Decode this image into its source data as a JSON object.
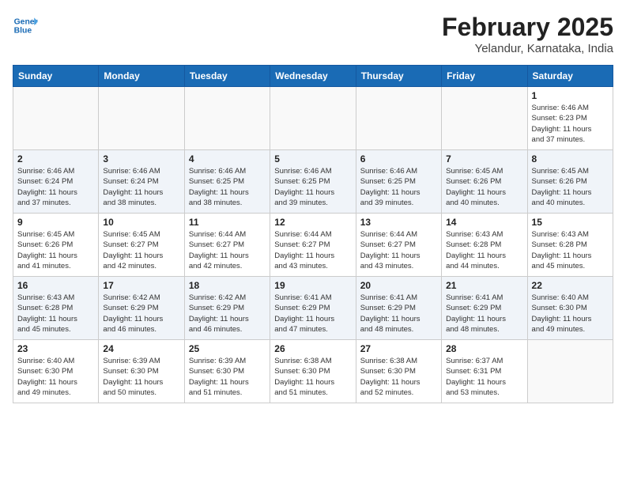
{
  "header": {
    "logo_line1": "General",
    "logo_line2": "Blue",
    "month": "February 2025",
    "location": "Yelandur, Karnataka, India"
  },
  "weekdays": [
    "Sunday",
    "Monday",
    "Tuesday",
    "Wednesday",
    "Thursday",
    "Friday",
    "Saturday"
  ],
  "weeks": [
    [
      {
        "day": "",
        "info": ""
      },
      {
        "day": "",
        "info": ""
      },
      {
        "day": "",
        "info": ""
      },
      {
        "day": "",
        "info": ""
      },
      {
        "day": "",
        "info": ""
      },
      {
        "day": "",
        "info": ""
      },
      {
        "day": "1",
        "info": "Sunrise: 6:46 AM\nSunset: 6:23 PM\nDaylight: 11 hours\nand 37 minutes."
      }
    ],
    [
      {
        "day": "2",
        "info": "Sunrise: 6:46 AM\nSunset: 6:24 PM\nDaylight: 11 hours\nand 37 minutes."
      },
      {
        "day": "3",
        "info": "Sunrise: 6:46 AM\nSunset: 6:24 PM\nDaylight: 11 hours\nand 38 minutes."
      },
      {
        "day": "4",
        "info": "Sunrise: 6:46 AM\nSunset: 6:25 PM\nDaylight: 11 hours\nand 38 minutes."
      },
      {
        "day": "5",
        "info": "Sunrise: 6:46 AM\nSunset: 6:25 PM\nDaylight: 11 hours\nand 39 minutes."
      },
      {
        "day": "6",
        "info": "Sunrise: 6:46 AM\nSunset: 6:25 PM\nDaylight: 11 hours\nand 39 minutes."
      },
      {
        "day": "7",
        "info": "Sunrise: 6:45 AM\nSunset: 6:26 PM\nDaylight: 11 hours\nand 40 minutes."
      },
      {
        "day": "8",
        "info": "Sunrise: 6:45 AM\nSunset: 6:26 PM\nDaylight: 11 hours\nand 40 minutes."
      }
    ],
    [
      {
        "day": "9",
        "info": "Sunrise: 6:45 AM\nSunset: 6:26 PM\nDaylight: 11 hours\nand 41 minutes."
      },
      {
        "day": "10",
        "info": "Sunrise: 6:45 AM\nSunset: 6:27 PM\nDaylight: 11 hours\nand 42 minutes."
      },
      {
        "day": "11",
        "info": "Sunrise: 6:44 AM\nSunset: 6:27 PM\nDaylight: 11 hours\nand 42 minutes."
      },
      {
        "day": "12",
        "info": "Sunrise: 6:44 AM\nSunset: 6:27 PM\nDaylight: 11 hours\nand 43 minutes."
      },
      {
        "day": "13",
        "info": "Sunrise: 6:44 AM\nSunset: 6:27 PM\nDaylight: 11 hours\nand 43 minutes."
      },
      {
        "day": "14",
        "info": "Sunrise: 6:43 AM\nSunset: 6:28 PM\nDaylight: 11 hours\nand 44 minutes."
      },
      {
        "day": "15",
        "info": "Sunrise: 6:43 AM\nSunset: 6:28 PM\nDaylight: 11 hours\nand 45 minutes."
      }
    ],
    [
      {
        "day": "16",
        "info": "Sunrise: 6:43 AM\nSunset: 6:28 PM\nDaylight: 11 hours\nand 45 minutes."
      },
      {
        "day": "17",
        "info": "Sunrise: 6:42 AM\nSunset: 6:29 PM\nDaylight: 11 hours\nand 46 minutes."
      },
      {
        "day": "18",
        "info": "Sunrise: 6:42 AM\nSunset: 6:29 PM\nDaylight: 11 hours\nand 46 minutes."
      },
      {
        "day": "19",
        "info": "Sunrise: 6:41 AM\nSunset: 6:29 PM\nDaylight: 11 hours\nand 47 minutes."
      },
      {
        "day": "20",
        "info": "Sunrise: 6:41 AM\nSunset: 6:29 PM\nDaylight: 11 hours\nand 48 minutes."
      },
      {
        "day": "21",
        "info": "Sunrise: 6:41 AM\nSunset: 6:29 PM\nDaylight: 11 hours\nand 48 minutes."
      },
      {
        "day": "22",
        "info": "Sunrise: 6:40 AM\nSunset: 6:30 PM\nDaylight: 11 hours\nand 49 minutes."
      }
    ],
    [
      {
        "day": "23",
        "info": "Sunrise: 6:40 AM\nSunset: 6:30 PM\nDaylight: 11 hours\nand 49 minutes."
      },
      {
        "day": "24",
        "info": "Sunrise: 6:39 AM\nSunset: 6:30 PM\nDaylight: 11 hours\nand 50 minutes."
      },
      {
        "day": "25",
        "info": "Sunrise: 6:39 AM\nSunset: 6:30 PM\nDaylight: 11 hours\nand 51 minutes."
      },
      {
        "day": "26",
        "info": "Sunrise: 6:38 AM\nSunset: 6:30 PM\nDaylight: 11 hours\nand 51 minutes."
      },
      {
        "day": "27",
        "info": "Sunrise: 6:38 AM\nSunset: 6:30 PM\nDaylight: 11 hours\nand 52 minutes."
      },
      {
        "day": "28",
        "info": "Sunrise: 6:37 AM\nSunset: 6:31 PM\nDaylight: 11 hours\nand 53 minutes."
      },
      {
        "day": "",
        "info": ""
      }
    ]
  ]
}
